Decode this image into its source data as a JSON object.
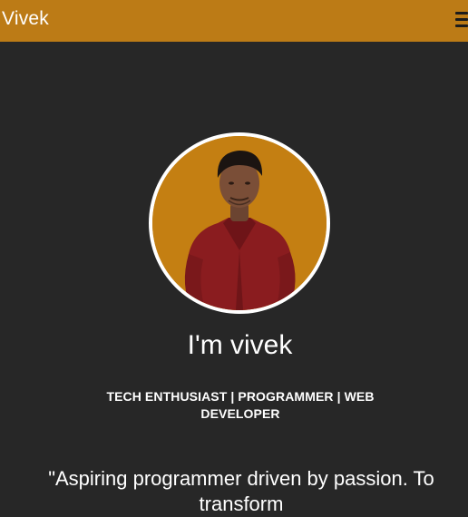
{
  "navbar": {
    "brand": "Vivek",
    "menu_icon": "hamburger-menu-icon",
    "background": "#bc7b16"
  },
  "hero": {
    "avatar_icon": "profile-photo",
    "greeting": "I'm vivek",
    "roles": "TECH ENTHUSIAST | PROGRAMMER | WEB DEVELOPER",
    "quote": "\"Aspiring programmer driven by passion. To transform"
  },
  "colors": {
    "page_background": "#272727",
    "accent": "#bc7b16",
    "text": "#ffffff"
  }
}
